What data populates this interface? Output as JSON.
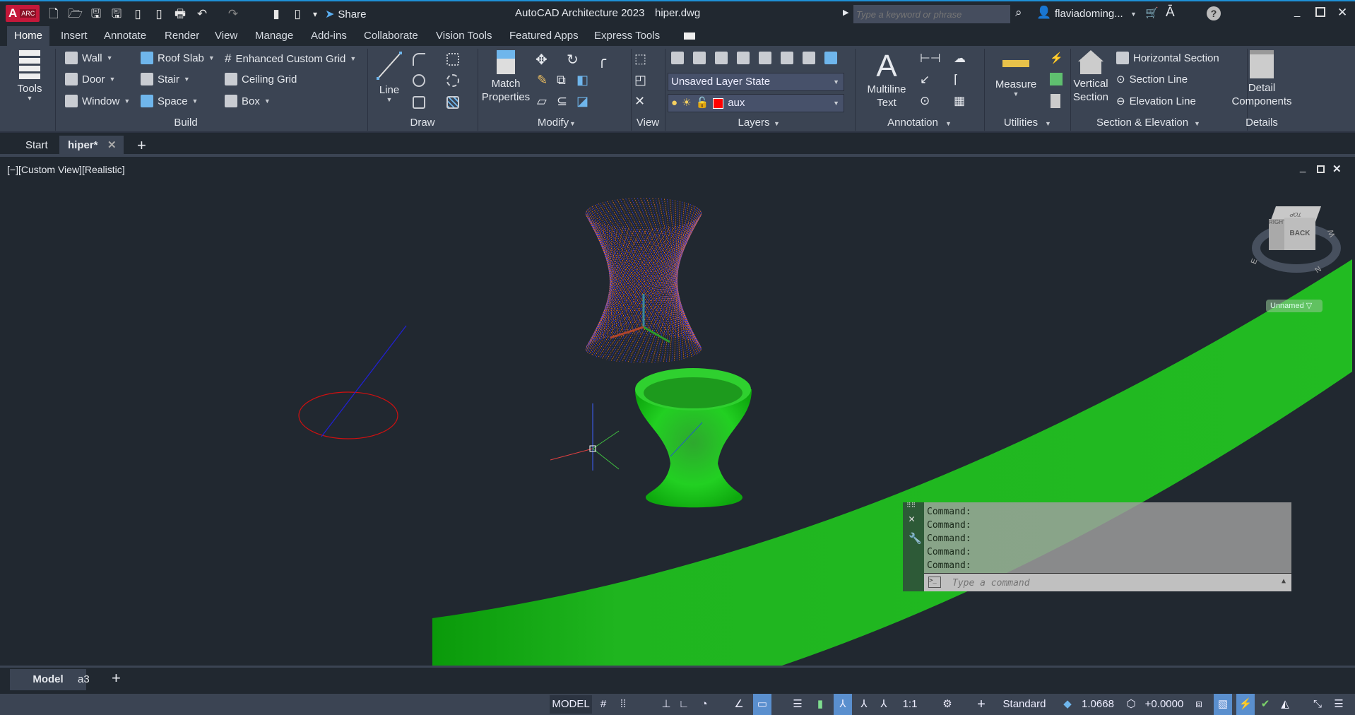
{
  "app": {
    "logo": "A",
    "logo_badge": "ARC",
    "title": "AutoCAD Architecture 2023",
    "file": "hiper.dwg",
    "share": "Share",
    "search_placeholder": "Type a keyword or phrase",
    "user": "flaviadoming...",
    "quick_access_icons": [
      "new-icon",
      "open-icon",
      "save-icon",
      "save-as-icon",
      "open-web-icon",
      "save-web-icon",
      "plot-icon",
      "undo-icon",
      "redo-icon"
    ]
  },
  "ribbon_tabs": [
    "Home",
    "Insert",
    "Annotate",
    "Render",
    "View",
    "Manage",
    "Add-ins",
    "Collaborate",
    "Vision Tools",
    "Featured Apps",
    "Express Tools"
  ],
  "ribbon": {
    "tools": "Tools",
    "build": {
      "label": "Build",
      "items": [
        "Wall",
        "Door",
        "Window",
        "Roof Slab",
        "Stair",
        "Space",
        "Enhanced Custom Grid",
        "Ceiling Grid",
        "Box"
      ]
    },
    "draw": {
      "label": "Draw",
      "line": "Line"
    },
    "modify": {
      "label": "Modify",
      "match": "Match",
      "properties": "Properties"
    },
    "view": {
      "label": "View"
    },
    "layers": {
      "label": "Layers",
      "layer_state": "Unsaved Layer State",
      "current_layer": "aux",
      "layer_color": "#ff0000"
    },
    "annotation": {
      "label": "Annotation",
      "multiline": "Multiline",
      "text": "Text"
    },
    "utilities": {
      "label": "Utilities",
      "measure": "Measure"
    },
    "section": {
      "label": "Section & Elevation",
      "vertical": "Vertical",
      "section": "Section",
      "horizontal": "Horizontal Section",
      "section_line": "Section Line",
      "elevation_line": "Elevation Line"
    },
    "details": {
      "label": "Details",
      "detail": "Detail",
      "components": "Components"
    }
  },
  "file_tabs": {
    "start": "Start",
    "active": "hiper*"
  },
  "viewport": {
    "label": "[−][Custom View][Realistic]",
    "viewcube": {
      "top": "TOP",
      "right": "RIGHT",
      "back": "BACK",
      "n": "N",
      "w": "W",
      "e": "E",
      "ucs": "Unnamed"
    }
  },
  "command": {
    "history": [
      "Command:",
      "Command:",
      "Command:",
      "Command:",
      "Command:"
    ],
    "placeholder": "Type a command"
  },
  "layout_tabs": [
    "Model",
    "a3"
  ],
  "status": {
    "model": "MODEL",
    "scale": "1:1",
    "annoscale": "Standard",
    "lineweight": "1.0668",
    "elevation": "+0.0000"
  }
}
